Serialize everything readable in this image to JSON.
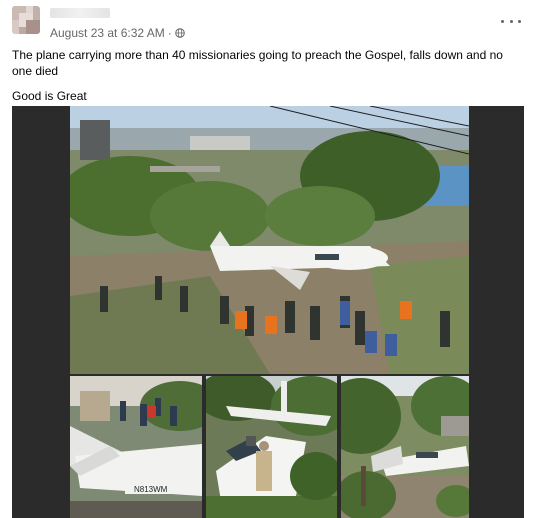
{
  "post": {
    "timestamp": "August 23 at 6:32 AM",
    "separator": "·",
    "text_line1": "The plane carrying more than 40 missionaries going to preach the Gospel, falls down and no one died",
    "text_line2": "Good is Great",
    "icons": [
      "globe-icon",
      "more-options-icon"
    ]
  },
  "photos": {
    "tail_number": "N813WM",
    "colors": {
      "sky": "#bcd0e4",
      "vegetation": "#4c6f30",
      "fuselage": "#f2f2f0",
      "ground": "#8d8068"
    }
  }
}
